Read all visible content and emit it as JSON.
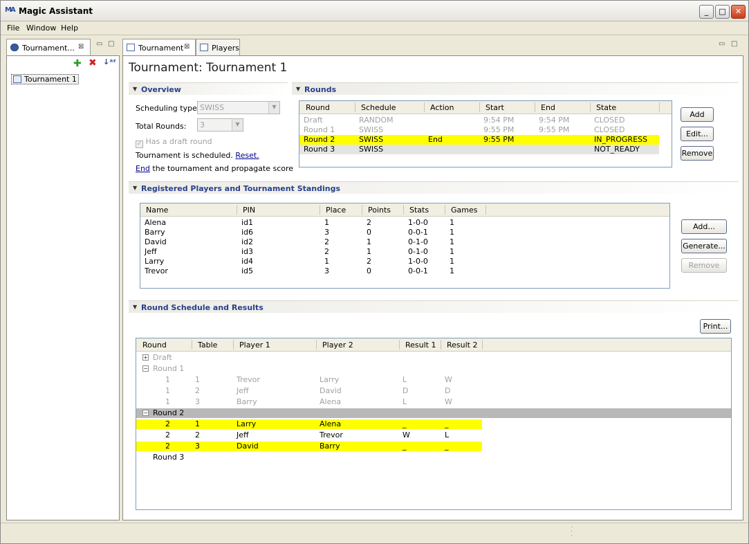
{
  "window": {
    "title": "Magic Assistant",
    "icon": "MA"
  },
  "menu": [
    "File",
    "Window",
    "Help"
  ],
  "left_panel": {
    "tab_label": "Tournament...",
    "tree_item": "Tournament 1"
  },
  "editor": {
    "tabs": [
      "Tournament",
      "Players"
    ],
    "title": "Tournament: Tournament 1"
  },
  "overview": {
    "header": "Overview",
    "scheduling_label": "Scheduling type:",
    "scheduling_value": "SWISS",
    "rounds_label": "Total Rounds:",
    "rounds_value": "3",
    "draft_checkbox": "Has a draft round",
    "scheduled_text": "Tournament is scheduled.",
    "reset_link": "Reset.",
    "end_link": "End",
    "end_text": "the tournament and propagate score"
  },
  "rounds": {
    "header": "Rounds",
    "columns": [
      "Round",
      "Schedule",
      "Action",
      "Start",
      "End",
      "State"
    ],
    "rows": [
      {
        "round": "Draft",
        "schedule": "RANDOM",
        "action": "",
        "start": "9:54 PM",
        "end": "9:54 PM",
        "state": "CLOSED"
      },
      {
        "round": "Round 1",
        "schedule": "SWISS",
        "action": "",
        "start": "9:55 PM",
        "end": "9:55 PM",
        "state": "CLOSED"
      },
      {
        "round": "Round 2",
        "schedule": "SWISS",
        "action": "End",
        "start": "9:55 PM",
        "end": "",
        "state": "IN_PROGRESS"
      },
      {
        "round": "Round 3",
        "schedule": "SWISS",
        "action": "",
        "start": "",
        "end": "",
        "state": "NOT_READY"
      }
    ],
    "buttons": [
      "Add",
      "Edit...",
      "Remove"
    ]
  },
  "players": {
    "header": "Registered Players and Tournament Standings",
    "columns": [
      "Name",
      "PIN",
      "Place",
      "Points",
      "Stats",
      "Games"
    ],
    "rows": [
      {
        "name": "Alena",
        "pin": "id1",
        "place": "1",
        "points": "2",
        "stats": "1-0-0",
        "games": "1"
      },
      {
        "name": "Barry",
        "pin": "id6",
        "place": "3",
        "points": "0",
        "stats": "0-0-1",
        "games": "1"
      },
      {
        "name": "David",
        "pin": "id2",
        "place": "2",
        "points": "1",
        "stats": "0-1-0",
        "games": "1"
      },
      {
        "name": "Jeff",
        "pin": "id3",
        "place": "2",
        "points": "1",
        "stats": "0-1-0",
        "games": "1"
      },
      {
        "name": "Larry",
        "pin": "id4",
        "place": "1",
        "points": "2",
        "stats": "1-0-0",
        "games": "1"
      },
      {
        "name": "Trevor",
        "pin": "id5",
        "place": "3",
        "points": "0",
        "stats": "0-0-1",
        "games": "1"
      }
    ],
    "buttons": [
      "Add...",
      "Generate...",
      "Remove"
    ]
  },
  "schedule": {
    "header": "Round Schedule and Results",
    "print_button": "Print...",
    "columns": [
      "Round",
      "Table",
      "Player 1",
      "Player 2",
      "Result 1",
      "Result 2"
    ],
    "groups": [
      "Draft",
      "Round 1",
      "Round 2",
      "Round 3"
    ],
    "round1": [
      {
        "round": "1",
        "table": "1",
        "p1": "Trevor",
        "p2": "Larry",
        "r1": "L",
        "r2": "W"
      },
      {
        "round": "1",
        "table": "2",
        "p1": "Jeff",
        "p2": "David",
        "r1": "D",
        "r2": "D"
      },
      {
        "round": "1",
        "table": "3",
        "p1": "Barry",
        "p2": "Alena",
        "r1": "L",
        "r2": "W"
      }
    ],
    "round2": [
      {
        "round": "2",
        "table": "1",
        "p1": "Larry",
        "p2": "Alena",
        "r1": "_",
        "r2": "_"
      },
      {
        "round": "2",
        "table": "2",
        "p1": "Jeff",
        "p2": "Trevor",
        "r1": "W",
        "r2": "L"
      },
      {
        "round": "2",
        "table": "3",
        "p1": "David",
        "p2": "Barry",
        "r1": "_",
        "r2": "_"
      }
    ]
  },
  "colors": {
    "highlight": "#ffff00",
    "selection": "#b8b8b8",
    "section_header": "#27418a"
  }
}
